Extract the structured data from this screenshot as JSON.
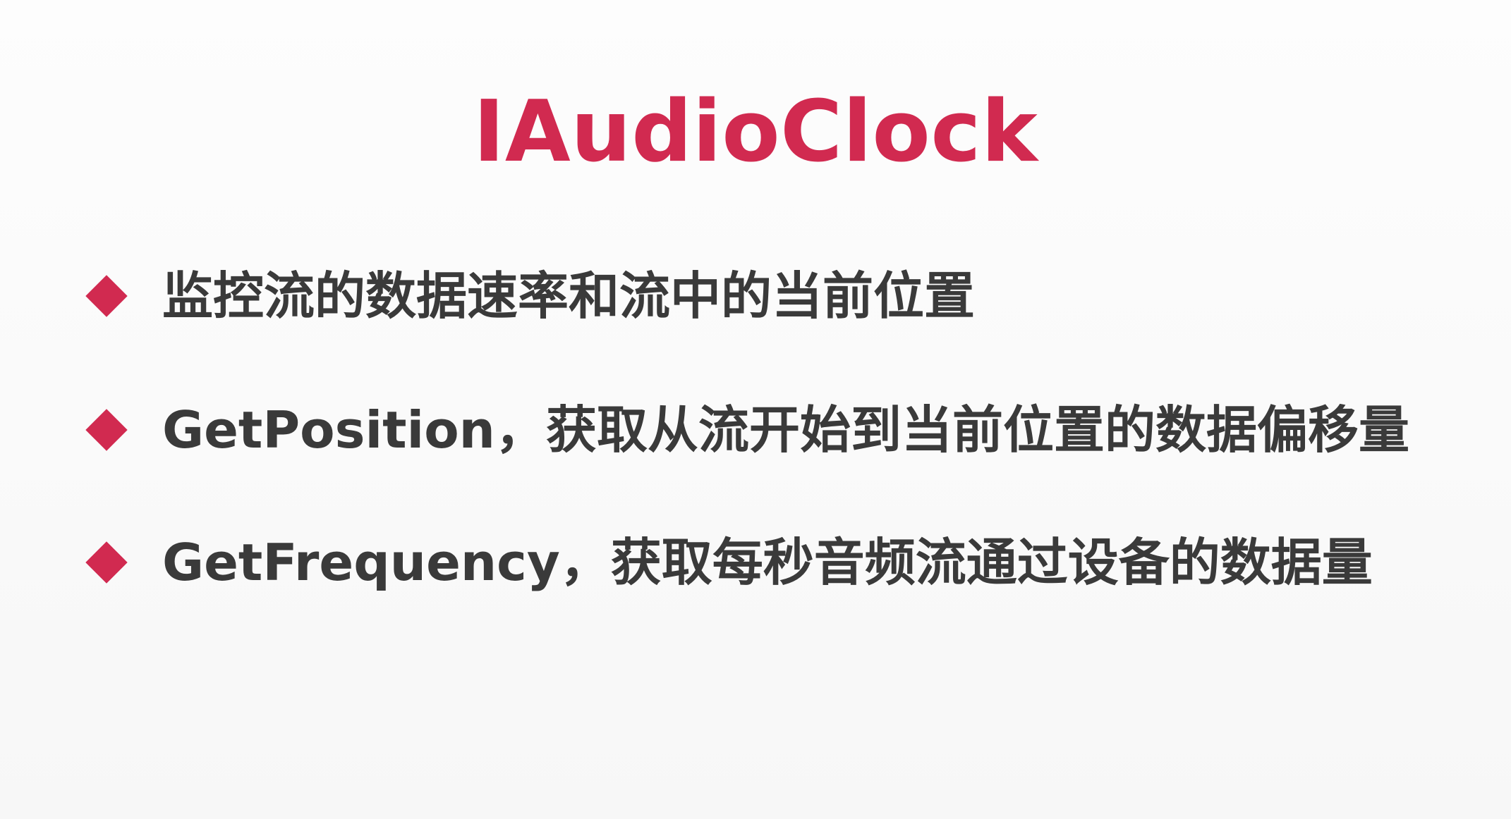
{
  "slide": {
    "title": "IAudioClock",
    "colors": {
      "accent": "#d12a50",
      "text": "#3a3a3a",
      "background": "#fdfdfd"
    },
    "bullets": [
      {
        "icon": "diamond-bullet-icon",
        "text": "监控流的数据速率和流中的当前位置"
      },
      {
        "icon": "diamond-bullet-icon",
        "text": "GetPosition，获取从流开始到当前位置的数据偏移量"
      },
      {
        "icon": "diamond-bullet-icon",
        "text": "GetFrequency，获取每秒音频流通过设备的数据量"
      }
    ]
  }
}
